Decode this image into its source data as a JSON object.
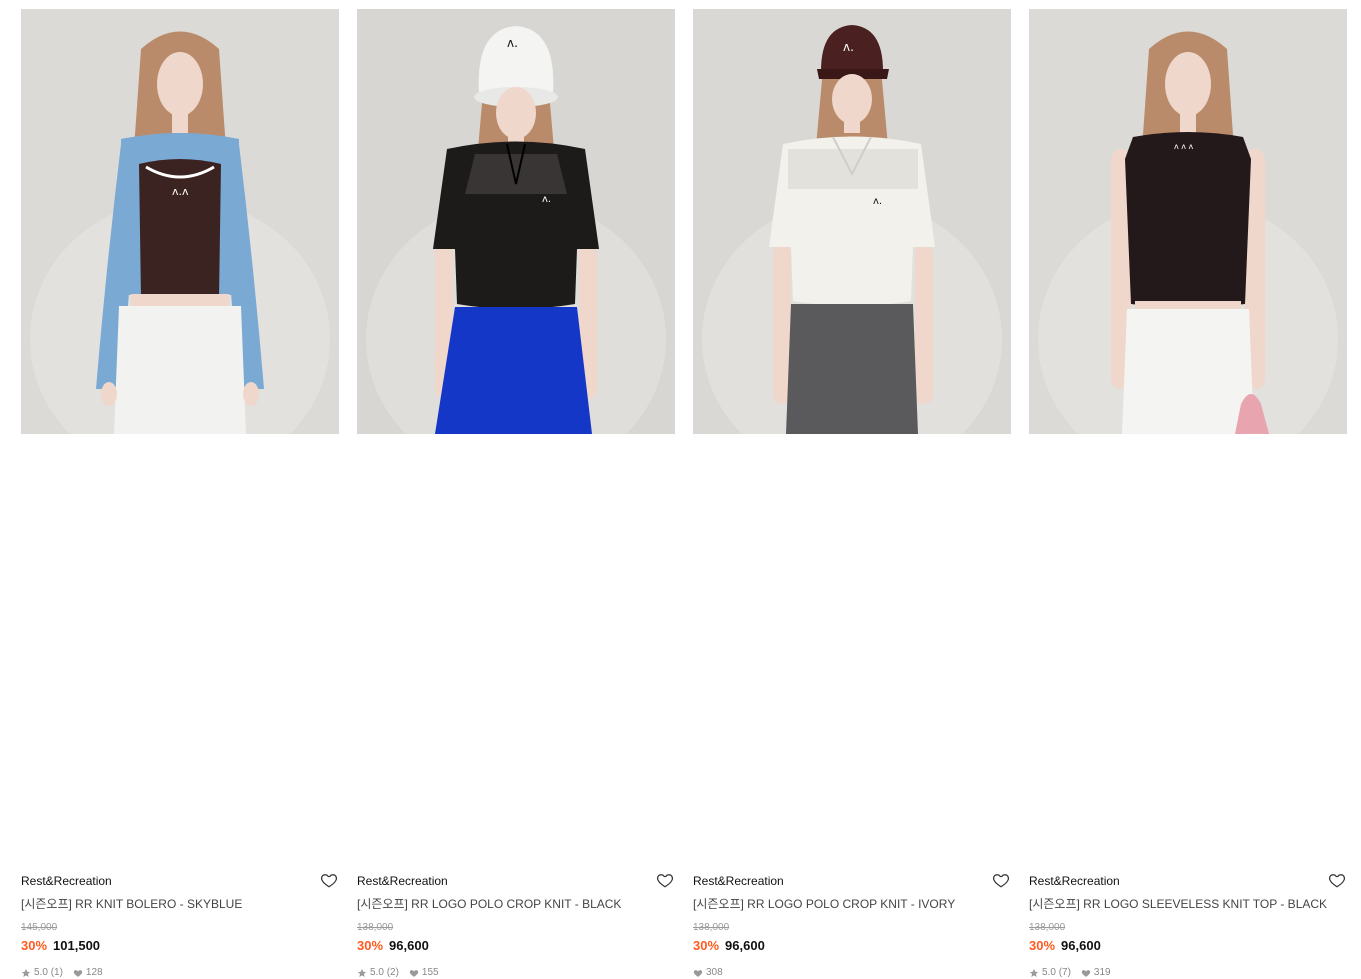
{
  "products": [
    {
      "brand": "Rest&Recreation",
      "name": "[시즌오프] RR KNIT BOLERO - SKYBLUE",
      "original_price": "145,000",
      "discount": "30%",
      "price": "101,500",
      "rating": "5.0",
      "review_count": "(1)",
      "likes": "128",
      "colors": {
        "top": "#3b2322",
        "sleeve": "#7aa9d4",
        "bottom": "#f2f2f0",
        "bg": "#dcdad7"
      }
    },
    {
      "brand": "Rest&Recreation",
      "name": "[시즌오프] RR LOGO POLO CROP KNIT - BLACK",
      "original_price": "138,000",
      "discount": "30%",
      "price": "96,600",
      "rating": "5.0",
      "review_count": "(2)",
      "likes": "155",
      "colors": {
        "top": "#1d1a1a",
        "sleeve": "#1d1a1a",
        "bottom": "#1437c8",
        "bg": "#d8d6d3",
        "hat": "#f4f4f2"
      }
    },
    {
      "brand": "Rest&Recreation",
      "name": "[시즌오프] RR LOGO POLO CROP KNIT - IVORY",
      "original_price": "138,000",
      "discount": "30%",
      "price": "96,600",
      "rating": "",
      "review_count": "",
      "likes": "308",
      "colors": {
        "top": "#f3f1ec",
        "sleeve": "#f3f1ec",
        "bottom": "#5a5a5c",
        "bg": "#dad8d5",
        "hat": "#4a2020"
      }
    },
    {
      "brand": "Rest&Recreation",
      "name": "[시즌오프] RR LOGO SLEEVELESS KNIT TOP - BLACK",
      "original_price": "138,000",
      "discount": "30%",
      "price": "96,600",
      "rating": "5.0",
      "review_count": "(7)",
      "likes": "319",
      "colors": {
        "top": "#24191a",
        "sleeve": "#f0d5c8",
        "bottom": "#f4f4f2",
        "bg": "#dcdad7"
      }
    }
  ]
}
